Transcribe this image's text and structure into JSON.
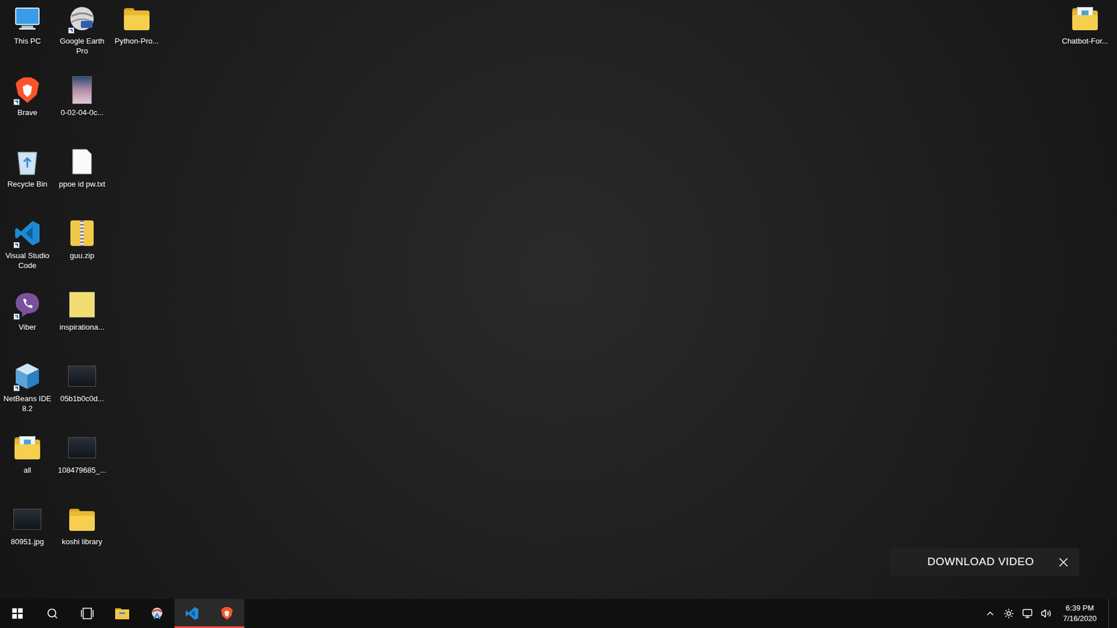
{
  "desktop_icons": [
    {
      "label": "This PC",
      "kind": "pc",
      "shortcut": false
    },
    {
      "label": "Brave",
      "kind": "brave",
      "shortcut": true
    },
    {
      "label": "Recycle Bin",
      "kind": "recycle",
      "shortcut": false
    },
    {
      "label": "Visual Studio Code",
      "kind": "vscode",
      "shortcut": true
    },
    {
      "label": "Viber",
      "kind": "viber",
      "shortcut": true
    },
    {
      "label": "NetBeans IDE 8.2",
      "kind": "netbeans",
      "shortcut": true
    },
    {
      "label": "all",
      "kind": "docs",
      "shortcut": false
    },
    {
      "label": "80951.jpg",
      "kind": "imagedark",
      "shortcut": false
    },
    {
      "label": "Google Earth Pro",
      "kind": "globe",
      "shortcut": true
    },
    {
      "label": "0-02-04-0c...",
      "kind": "image",
      "shortcut": false
    },
    {
      "label": "ppoe id pw.txt",
      "kind": "text",
      "shortcut": false
    },
    {
      "label": "guu.zip",
      "kind": "zip",
      "shortcut": false
    },
    {
      "label": "inspirationa...",
      "kind": "note",
      "shortcut": false
    },
    {
      "label": "05b1b0c0d...",
      "kind": "imagedark",
      "shortcut": false
    },
    {
      "label": "108479685_...",
      "kind": "imagedark",
      "shortcut": false
    },
    {
      "label": "koshi library",
      "kind": "folder",
      "shortcut": false
    },
    {
      "label": "Python-Pro...",
      "kind": "folder",
      "shortcut": false
    }
  ],
  "desktop_icons_right": [
    {
      "label": "Chatbot-For...",
      "kind": "docs",
      "shortcut": false
    }
  ],
  "popup": {
    "label": "DOWNLOAD VIDEO"
  },
  "taskbar": {
    "apps": [
      {
        "kind": "start",
        "active": false
      },
      {
        "kind": "search",
        "active": false
      },
      {
        "kind": "taskview",
        "active": false
      },
      {
        "kind": "explorer",
        "active": false
      },
      {
        "kind": "app",
        "active": false
      },
      {
        "kind": "vscode",
        "active": true
      },
      {
        "kind": "brave",
        "active": true
      }
    ],
    "clock": {
      "time": "6:39 PM",
      "date": "7/16/2020"
    }
  }
}
